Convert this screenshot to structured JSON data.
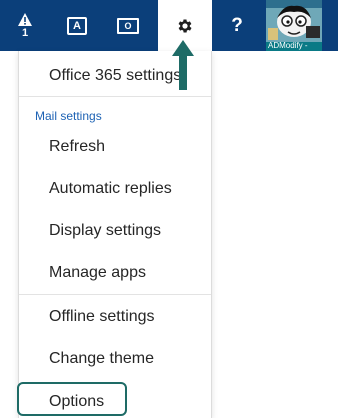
{
  "topbar": {
    "alerts_count": "1",
    "word_letter": "A",
    "outlook_letter": "O",
    "help_label": "?",
    "avatar_caption": "ADModify -"
  },
  "menu": {
    "office_settings": "Office 365 settings",
    "mail_settings_header": "Mail settings",
    "items": [
      "Refresh",
      "Automatic replies",
      "Display settings",
      "Manage apps",
      "Offline settings",
      "Change theme",
      "Options"
    ]
  },
  "colors": {
    "topbar": "#0b3f7a",
    "accent_link": "#1d62b4",
    "annotation": "#1e6b66"
  },
  "icons": {
    "alerts": "warning-icon",
    "word": "word-app-icon",
    "outlook": "outlook-app-icon",
    "settings": "gear-icon",
    "help": "help-icon",
    "avatar": "avatar"
  }
}
